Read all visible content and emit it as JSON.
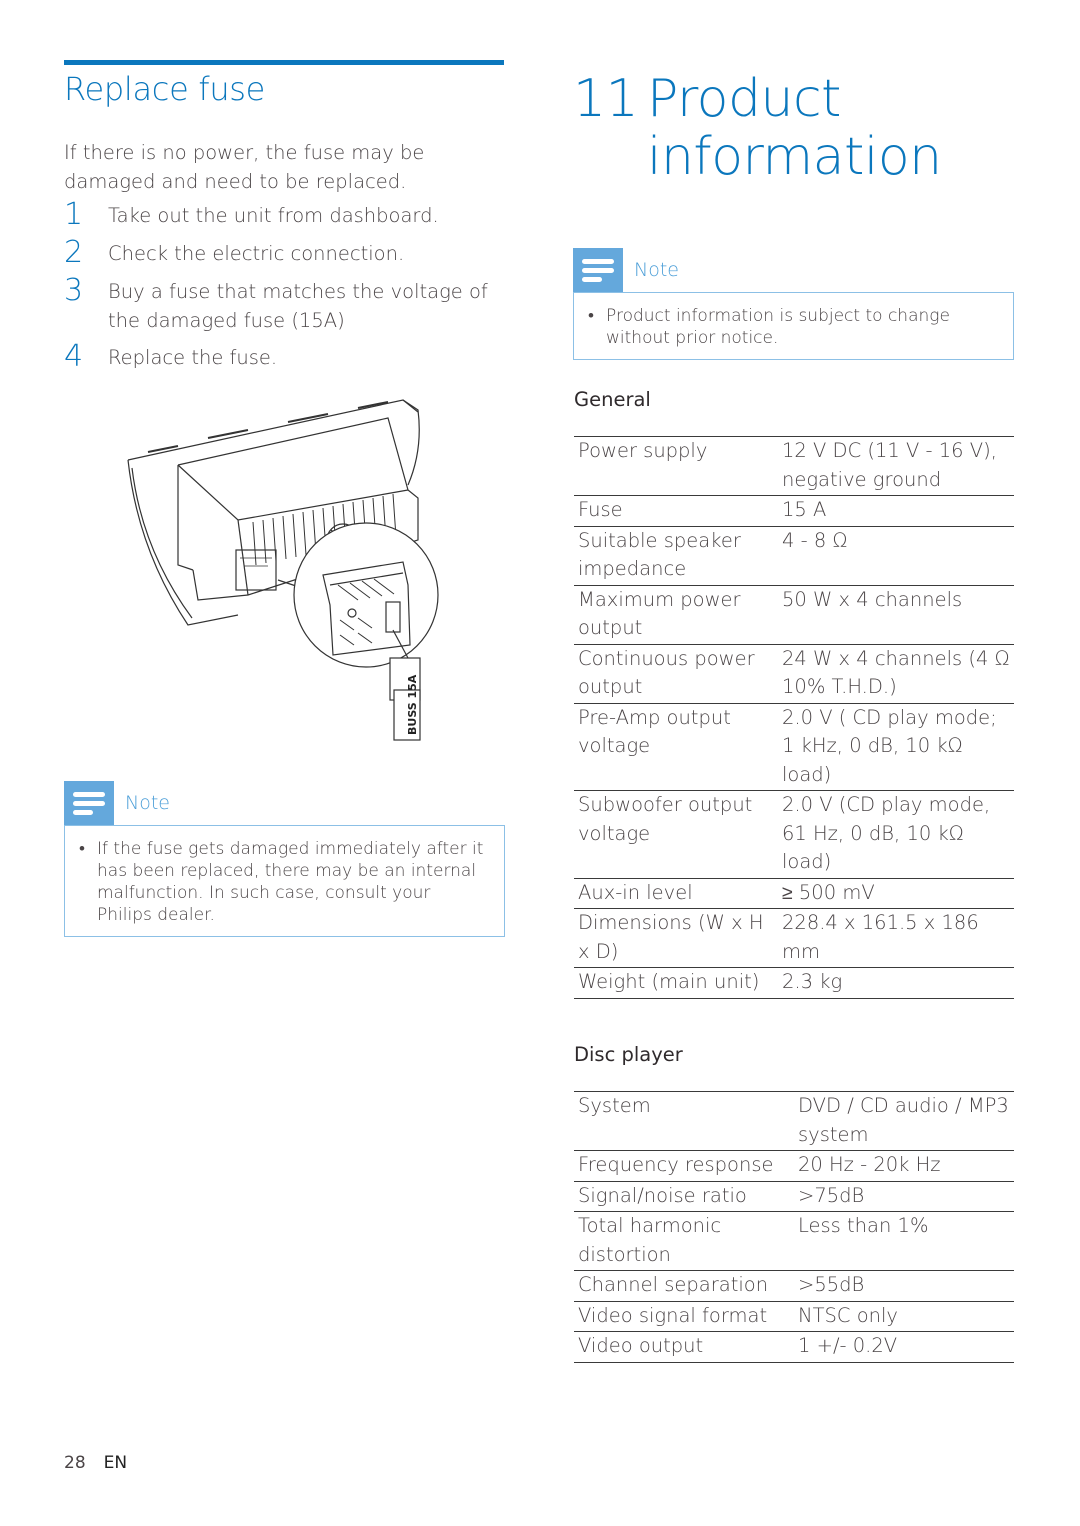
{
  "left": {
    "section_title": "Replace fuse",
    "intro": "If there is no power, the fuse may be damaged and need to be replaced.",
    "steps": [
      {
        "num": "1",
        "text": "Take out the unit from dashboard."
      },
      {
        "num": "2",
        "text": "Check the electric connection."
      },
      {
        "num": "3",
        "text": "Buy a fuse that matches the voltage of the damaged fuse (15A)"
      },
      {
        "num": "4",
        "text": "Replace the fuse."
      }
    ],
    "illustration": {
      "description": "Rear view of car stereo unit with magnified connector and fuse",
      "fuse_label": "BUSS 15A"
    },
    "note": {
      "icon": "note-lines-icon",
      "label": "Note",
      "items": [
        "If the fuse gets damaged immediately after it has been replaced, there may be an internal malfunction. In such case, consult your Philips dealer."
      ]
    }
  },
  "right": {
    "chapter_number": "11",
    "chapter_title_line1": "Product",
    "chapter_title_line2": "information",
    "note": {
      "icon": "note-lines-icon",
      "label": "Note",
      "items": [
        "Product information is subject to change without prior notice."
      ]
    },
    "general": {
      "title": "General",
      "rows": [
        {
          "label": "Power supply",
          "value": "12 V DC (11 V - 16 V), negative ground"
        },
        {
          "label": "Fuse",
          "value": "15 A"
        },
        {
          "label": "Suitable speaker impedance",
          "value": "4 - 8  Ω"
        },
        {
          "label": "Maximum power output",
          "value": "50 W x 4 channels"
        },
        {
          "label": "Continuous power output",
          "value": "24 W x 4 channels (4 Ω 10% T.H.D.)"
        },
        {
          "label": "Pre-Amp output voltage",
          "value": "2.0 V ( CD play mode; 1 kHz, 0 dB, 10 kΩ load)"
        },
        {
          "label": "Subwoofer output voltage",
          "value": "2.0 V (CD play mode, 61 Hz, 0 dB, 10 kΩ load)"
        },
        {
          "label": "Aux-in level",
          "value": "≥ 500 mV"
        },
        {
          "label": "Dimensions (W x H x D)",
          "value": "228.4 x 161.5 x 186 mm"
        },
        {
          "label": "Weight (main unit)",
          "value": "2.3 kg"
        }
      ]
    },
    "disc": {
      "title": "Disc player",
      "rows": [
        {
          "label": "System",
          "value": "DVD / CD audio / MP3 system"
        },
        {
          "label": "Frequency response",
          "value": "20 Hz - 20k Hz"
        },
        {
          "label": "Signal/noise ratio",
          "value": ">75dB"
        },
        {
          "label": "Total harmonic distortion",
          "value": "Less than 1%"
        },
        {
          "label": "Channel separation",
          "value": ">55dB"
        },
        {
          "label": "Video signal format",
          "value": "NTSC only"
        },
        {
          "label": "Video output",
          "value": "1 +/- 0.2V"
        }
      ]
    }
  },
  "footer": {
    "page_number": "28",
    "language": "EN"
  },
  "colors": {
    "accent_blue": "#0b77bd",
    "note_blue": "#64a8dc",
    "note_border": "#8cc0e6",
    "text": "#4a4446"
  }
}
